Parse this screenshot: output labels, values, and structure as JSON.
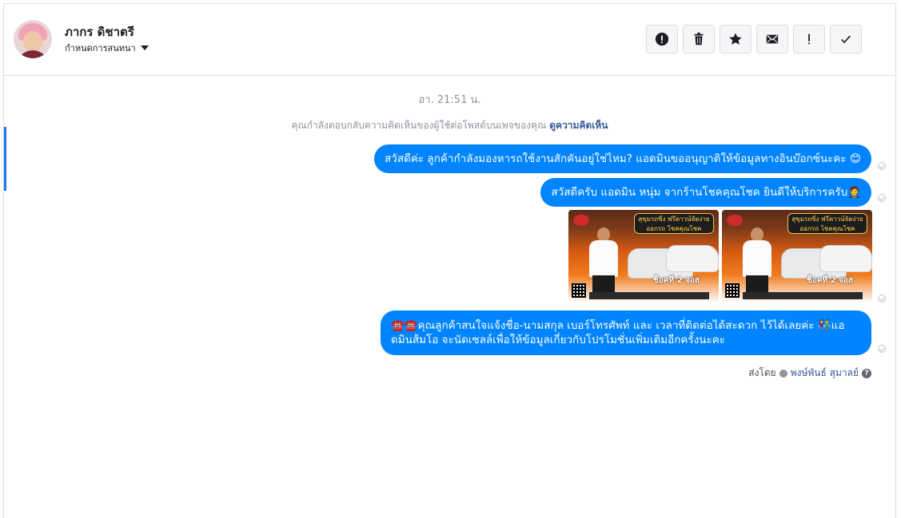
{
  "header": {
    "name": "ภากร ดิชาตรี",
    "label_setting": "กำหนดการสนทนา"
  },
  "toolbar": [
    {
      "name": "report-button",
      "icon": "alert-circle-icon"
    },
    {
      "name": "delete-button",
      "icon": "trash-icon"
    },
    {
      "name": "star-button",
      "icon": "star-icon"
    },
    {
      "name": "mark-unread-button",
      "icon": "envelope-icon"
    },
    {
      "name": "follow-up-button",
      "icon": "exclamation-icon"
    },
    {
      "name": "mark-done-button",
      "icon": "check-icon"
    }
  ],
  "conversation": {
    "timestamp": "อา. 21:51 น.",
    "context_text": "คุณกำลังตอบกลับความคิดเห็นของผู้ใช้ต่อโพสต์บนเพจของคุณ",
    "context_link": "ดูความคิดเห็น",
    "messages": [
      {
        "text": "สวัสดีค่ะ ลูกค้ากำลังมองหารถใช้งานสักคันอยู่ใช่ไหม? แอดมินขออนุญาติให้ข้อมูลทางอินบ๊อกซ์นะคะ 😊"
      },
      {
        "text": "สวัสดีครับ แอดมิน หนุ่ม จากร้านโชคคุณโชค ยินดีให้บริการครับ🤵"
      },
      {
        "text": "☎️☎️คุณลูกค้าสนใจแจ้งชื่อ-นามสกุล เบอร์โทรศัพท์ และ เวลาที่ติดต่อได้สะดวก ไว้ได้เลยค่ะ 👫แอดมินส้มโอ จะนัดเซลล์เพื่อให้ข้อมูลเกี่ยวกับโปรโมชั่นเพิ่มเติมอีกครั้งนะคะ"
      }
    ],
    "ad_images": [
      {
        "banner": "สุขุมรถซิ่ง ฟรีดาวน์จัดง่าย ออกรถ โชคคุณโชค",
        "cta": "ช็อคที่ 2 จอส"
      },
      {
        "banner": "สุขุมรถซิ่ง ฟรีดาวน์จัดง่าย ออกรถ โชคคุณโชค",
        "cta": "ช็อคที่ 2 จอส"
      }
    ],
    "sent_by_label": "ส่งโดย",
    "sent_by_name": "พงษ์พันธ์ สุมาลย์"
  },
  "colors": {
    "bubble": "#0084ff",
    "accent": "#1877f2"
  }
}
